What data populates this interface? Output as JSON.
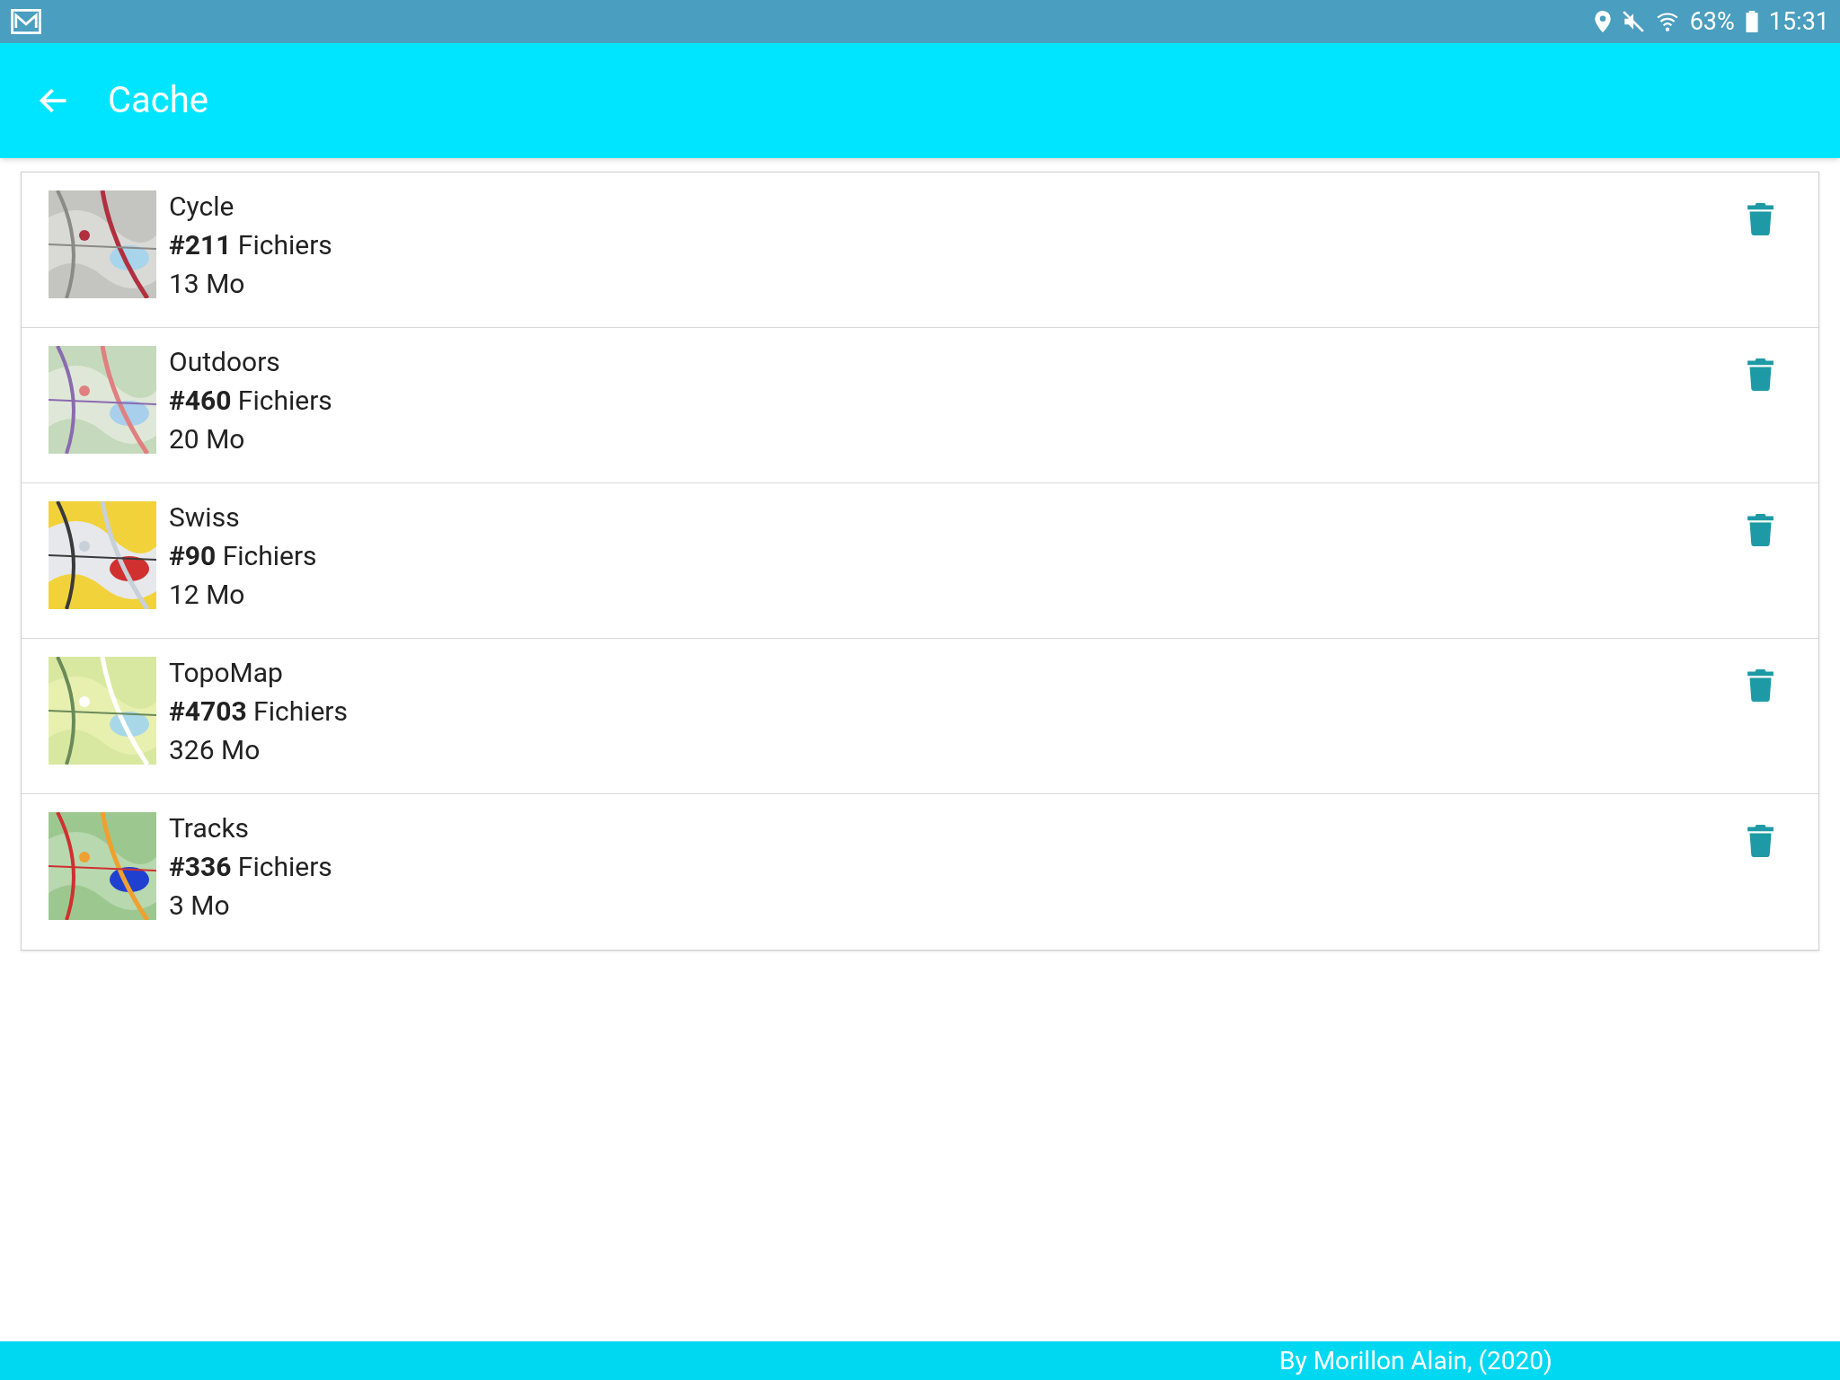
{
  "status_bar": {
    "battery": "63%",
    "time": "15:31"
  },
  "app_bar": {
    "title": "Cache"
  },
  "caches": [
    {
      "name": "Cycle",
      "files": "**#211** Fichiers",
      "size": "13 Mo"
    },
    {
      "name": "Outdoors",
      "files": "**#460** Fichiers",
      "size": "20 Mo"
    },
    {
      "name": "Swiss",
      "files": "**#90** Fichiers",
      "size": "12 Mo"
    },
    {
      "name": "TopoMap",
      "files": "**#4703** Fichiers",
      "size": "326 Mo"
    },
    {
      "name": "Tracks",
      "files": "**#336** Fichiers",
      "size": "3 Mo"
    }
  ],
  "footer": "By Morillon Alain, (2020)"
}
